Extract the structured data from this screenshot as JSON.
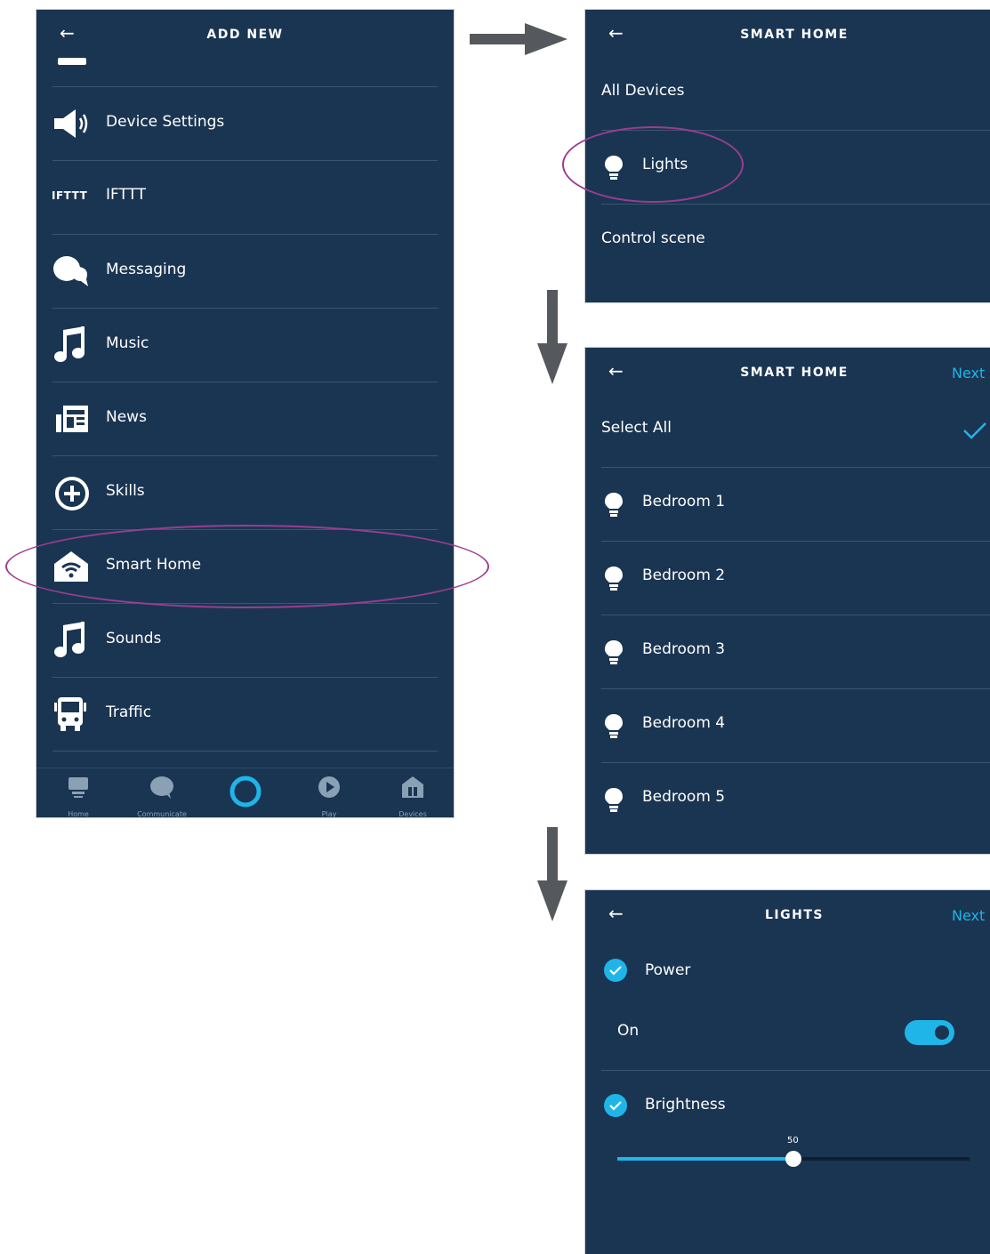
{
  "colors": {
    "panel_bg": "#1a3552",
    "accent": "#1fb5e8",
    "highlight": "#9b3d8f",
    "divider": "#3b5570",
    "arrow": "#55595e"
  },
  "screen1": {
    "title": "ADD NEW",
    "items": [
      {
        "label": "Device Settings",
        "icon": "speaker-icon"
      },
      {
        "label": "IFTTT",
        "icon": "ifttt-icon",
        "icon_text": "IFTTT"
      },
      {
        "label": "Messaging",
        "icon": "chat-bubbles-icon"
      },
      {
        "label": "Music",
        "icon": "music-note-icon"
      },
      {
        "label": "News",
        "icon": "news-icon"
      },
      {
        "label": "Skills",
        "icon": "skills-icon"
      },
      {
        "label": "Smart Home",
        "icon": "smart-home-icon"
      },
      {
        "label": "Sounds",
        "icon": "music-note-icon"
      },
      {
        "label": "Traffic",
        "icon": "bus-icon"
      }
    ],
    "nav": [
      {
        "label": "Home",
        "icon": "home-icon"
      },
      {
        "label": "Communicate",
        "icon": "chat-icon"
      },
      {
        "label": "",
        "icon": "alexa-ring-icon"
      },
      {
        "label": "Play",
        "icon": "play-icon"
      },
      {
        "label": "Devices",
        "icon": "devices-icon"
      }
    ]
  },
  "screen2": {
    "title": "SMART HOME",
    "items": [
      {
        "label": "All Devices"
      },
      {
        "label": "Lights",
        "icon": "bulb-icon"
      },
      {
        "label": "Control scene"
      }
    ]
  },
  "screen3": {
    "title": "SMART HOME",
    "next_label": "Next",
    "select_all_label": "Select All",
    "items": [
      {
        "label": "Bedroom 1"
      },
      {
        "label": "Bedroom 2"
      },
      {
        "label": "Bedroom 3"
      },
      {
        "label": "Bedroom 4"
      },
      {
        "label": "Bedroom 5"
      }
    ]
  },
  "screen4": {
    "title": "LIGHTS",
    "next_label": "Next",
    "power_label": "Power",
    "on_label": "On",
    "power_on": true,
    "brightness_label": "Brightness",
    "brightness_value": "50",
    "brightness_fraction": 0.5
  }
}
